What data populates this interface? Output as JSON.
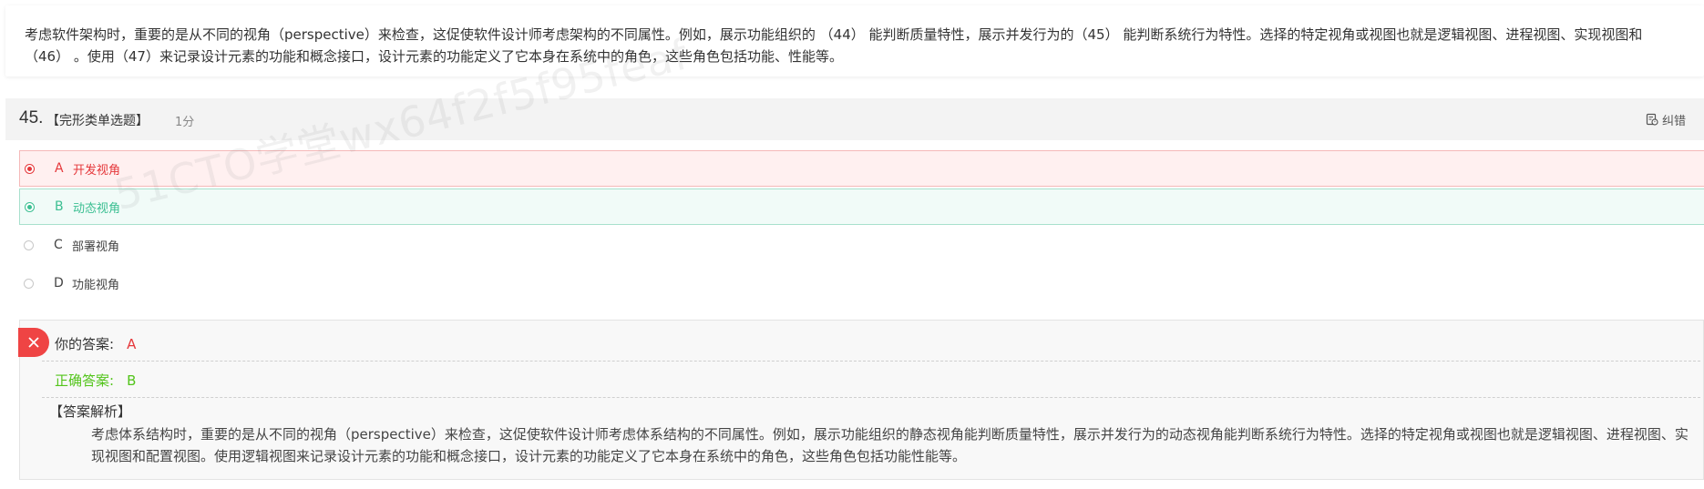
{
  "passage": {
    "text": "考虑软件架构时，重要的是从不同的视角（perspective）来检查，这促使软件设计师考虑架构的不同属性。例如，展示功能组织的 （44） 能判断质量特性，展示并发行为的（45） 能判断系统行为特性。选择的特定视角或视图也就是逻辑视图、进程视图、实现视图和 （46） 。使用（47）来记录设计元素的功能和概念接口，设计元素的功能定义了它本身在系统中的角色，这些角色包括功能、性能等。"
  },
  "question": {
    "number": "45.",
    "type": "【完形类单选题】",
    "score": "1分",
    "report_label": "纠错"
  },
  "options": [
    {
      "letter": "A",
      "text": "开发视角",
      "state": "wrong"
    },
    {
      "letter": "B",
      "text": "动态视角",
      "state": "correct"
    },
    {
      "letter": "C",
      "text": "部署视角",
      "state": "none"
    },
    {
      "letter": "D",
      "text": "功能视角",
      "state": "none"
    }
  ],
  "answer": {
    "your_answer_label": "你的答案:",
    "your_answer_value": "A",
    "correct_answer_label": "正确答案:",
    "correct_answer_value": "B",
    "analysis_title": "【答案解析】",
    "analysis_text": "考虑体系结构时，重要的是从不同的视角（perspective）来检查，这促使软件设计师考虑体系结构的不同属性。例如，展示功能组织的静态视角能判断质量特性，展示并发行为的动态视角能判断系统行为特性。选择的特定视角或视图也就是逻辑视图、进程视图、实现视图和配置视图。使用逻辑视图来记录设计元素的功能和概念接口，设计元素的功能定义了它本身在系统中的角色，这些角色包括功能性能等。"
  },
  "watermark": "51CTO学堂wx64f2f5f95feaf",
  "colors": {
    "wrong": "#e5383b",
    "correct": "#3cbf92",
    "correct_answer_text": "#52c41a"
  }
}
